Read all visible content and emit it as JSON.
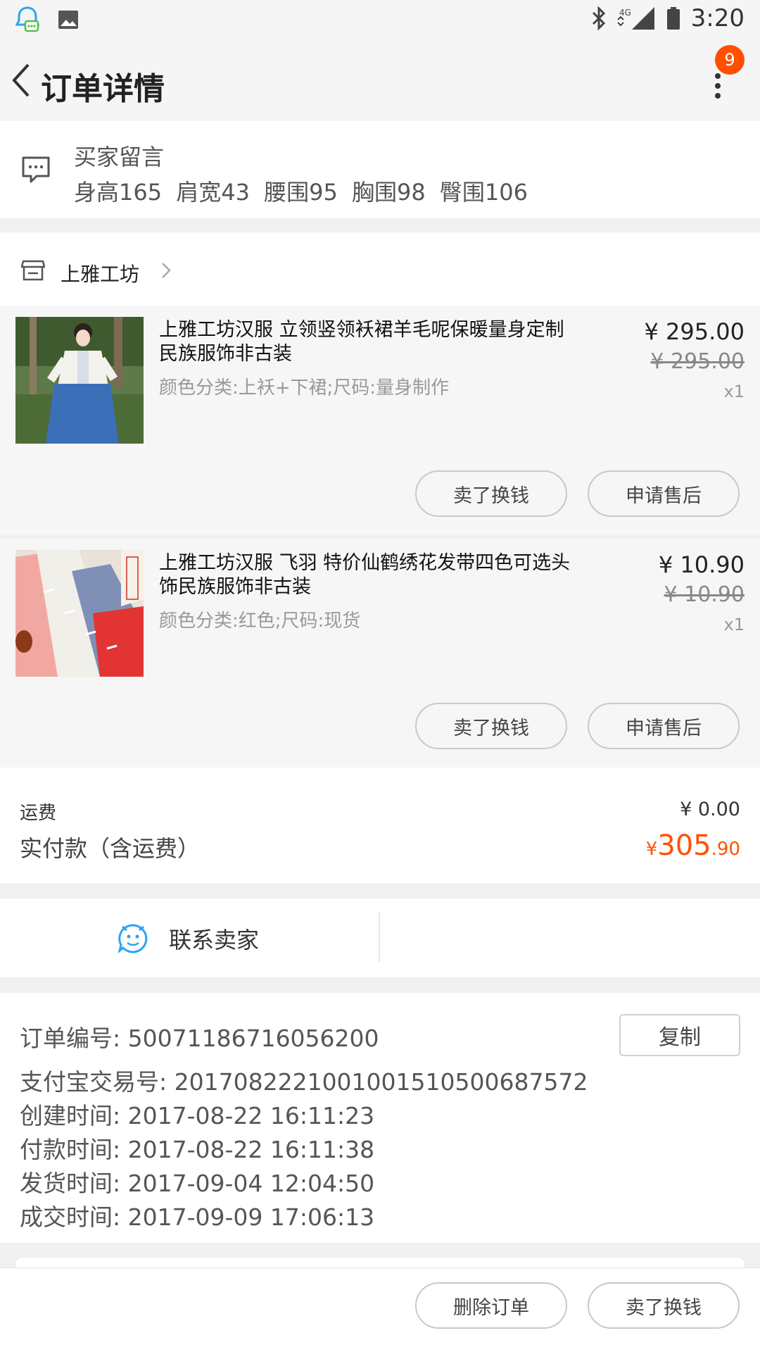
{
  "status_bar": {
    "time": "3:20",
    "network": "4G"
  },
  "header": {
    "title": "订单详情",
    "badge_count": "9"
  },
  "buyer_message": {
    "title": "买家留言",
    "text": "身高165  肩宽43  腰围95  胸围98  臀围106"
  },
  "shop": {
    "name": "上雅工坊"
  },
  "items": [
    {
      "title": "上雅工坊汉服 立领竖领袄裙羊毛呢保暖量身定制 民族服饰非古装",
      "sku": "颜色分类:上袄+下裙;尺码:量身制作",
      "price": "¥ 295.00",
      "original_price": "¥ 295.00",
      "qty": "x1",
      "btn_sell": "卖了换钱",
      "btn_after_sale": "申请售后"
    },
    {
      "title": "上雅工坊汉服 飞羽 特价仙鹤绣花发带四色可选头饰民族服饰非古装",
      "sku": "颜色分类:红色;尺码:现货",
      "price": "¥ 10.90",
      "original_price": "¥ 10.90",
      "qty": "x1",
      "btn_sell": "卖了换钱",
      "btn_after_sale": "申请售后"
    }
  ],
  "fees": {
    "shipping_label": "运费",
    "shipping_value": "¥ 0.00",
    "paid_label": "实付款（含运费）",
    "paid_currency": "¥",
    "paid_int": "305",
    "paid_dec": ".90"
  },
  "contact": {
    "label": "联系卖家"
  },
  "order_info": {
    "order_no": "订单编号:  50071186716056200",
    "alipay_no": "支付宝交易号:  2017082221001001510500687572",
    "created": "创建时间:  2017-08-22 16:11:23",
    "paid": "付款时间:  2017-08-22 16:11:38",
    "shipped": "发货时间:  2017-09-04 12:04:50",
    "completed": "成交时间:  2017-09-09 17:06:13",
    "copy_label": "复制"
  },
  "bottom": {
    "delete_label": "删除订单",
    "sell_label": "卖了换钱"
  },
  "colors": {
    "accent": "#ff5000",
    "contact_icon": "#2aa3f5"
  }
}
